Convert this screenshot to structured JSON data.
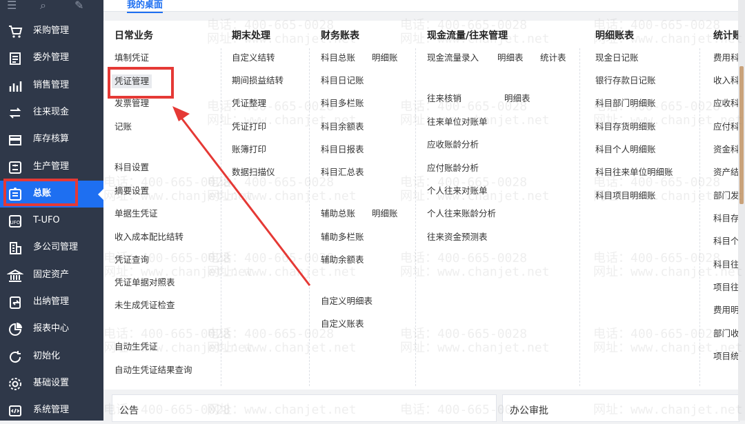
{
  "tab_bar": {
    "active_tab": "我的桌面"
  },
  "sidebar": {
    "items": [
      {
        "label": "采购管理",
        "icon": "cart-icon"
      },
      {
        "label": "委外管理",
        "icon": "outsource-icon"
      },
      {
        "label": "销售管理",
        "icon": "sales-chart-icon"
      },
      {
        "label": "往来现金",
        "icon": "exchange-icon"
      },
      {
        "label": "库存核算",
        "icon": "inventory-icon"
      },
      {
        "label": "生产管理",
        "icon": "production-icon"
      },
      {
        "label": "总账",
        "icon": "ledger-icon",
        "active": true
      },
      {
        "label": "T-UFO",
        "icon": "ufo-icon"
      },
      {
        "label": "多公司管理",
        "icon": "building-icon"
      },
      {
        "label": "固定资产",
        "icon": "bank-icon"
      },
      {
        "label": "出纳管理",
        "icon": "cashier-icon"
      },
      {
        "label": "报表中心",
        "icon": "pie-chart-icon"
      },
      {
        "label": "初始化",
        "icon": "refresh-icon"
      },
      {
        "label": "基础设置",
        "icon": "gear-icon"
      },
      {
        "label": "系统管理",
        "icon": "code-icon"
      }
    ]
  },
  "menu": {
    "daily": {
      "title": "日常业务",
      "items": [
        "填制凭证",
        "凭证管理",
        "发票管理",
        "记账",
        "科目设置",
        "摘要设置",
        "单据生凭证",
        "收入成本配比结转",
        "凭证查询",
        "凭证单据对照表",
        "未生成凭证检查",
        "自动生凭证",
        "自动生凭证结果查询"
      ]
    },
    "period_end": {
      "title": "期末处理",
      "items": [
        "自定义结转",
        "期间损益结转",
        "凭证整理",
        "凭证打印",
        "账簿打印",
        "数据扫描仪"
      ]
    },
    "finance": {
      "title": "财务账表",
      "items": [
        "科目总账",
        "明细账",
        "科目日记账",
        "科目多栏账",
        "科目余额表",
        "科目日报表",
        "科目汇总表",
        "辅助总账",
        "明细账",
        "辅助多栏账",
        "辅助余额表",
        "自定义明细表",
        "自定义账表"
      ]
    },
    "cashflow": {
      "title": "现金流量/往来管理",
      "items": [
        "现金流量录入",
        "明细表",
        "统计表",
        "往来核销",
        "明细表",
        "往来单位对账单",
        "应收账龄分析",
        "应付账龄分析",
        "个人往来对账单",
        "个人往来账龄分析",
        "往来资金预测表"
      ]
    },
    "detail": {
      "title": "明细账表",
      "items": [
        "现金日记账",
        "银行存款日记账",
        "科目部门明细账",
        "科目存货明细账",
        "科目个人明细账",
        "科目往来单位明细账",
        "科目项目明细账"
      ]
    },
    "stats": {
      "title": "统计账",
      "items": [
        "费用科",
        "收入科",
        "应收科",
        "应付科",
        "资金科",
        "资产结",
        "部门发",
        "科目存",
        "科目个",
        "科目往",
        "项目往",
        "费用明",
        "部门收",
        "项目统"
      ]
    }
  },
  "bottom": {
    "notice": "公告",
    "approval": "办公审批"
  },
  "watermark": {
    "phone": "电话：400-665-0028",
    "site": "网址：www.chanjet.net"
  },
  "colors": {
    "sidebar_bg": "#2f3849",
    "accent": "#1e6ff1",
    "annotation": "#e53935"
  }
}
